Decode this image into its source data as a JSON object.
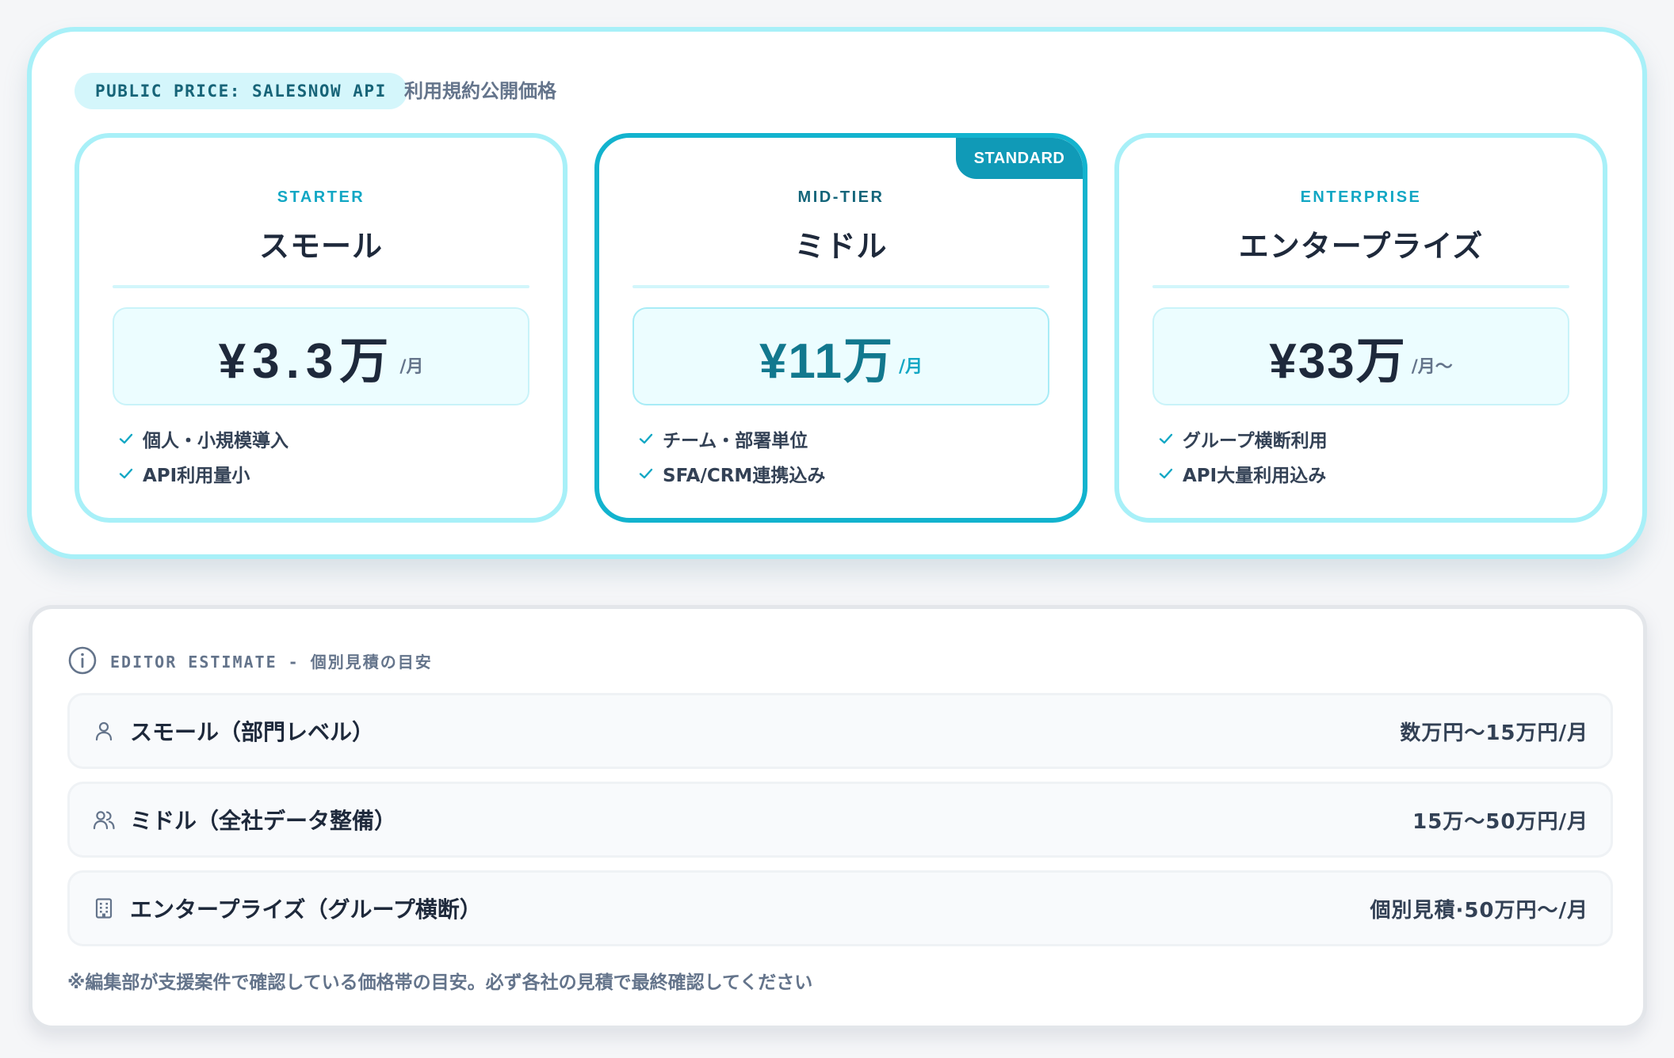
{
  "public_price": {
    "badge": "PUBLIC PRICE: SALESNOW API",
    "caption": "利用規約公開価格",
    "plans": [
      {
        "tier": "STARTER",
        "name": "スモール",
        "price": "¥3.3万",
        "unit": "/月",
        "features": [
          "個人・小規模導入",
          "API利用量小"
        ]
      },
      {
        "tier": "MID-TIER",
        "name": "ミドル",
        "price": "¥11万",
        "unit": "/月",
        "ribbon": "STANDARD",
        "features": [
          "チーム・部署単位",
          "SFA/CRM連携込み"
        ]
      },
      {
        "tier": "ENTERPRISE",
        "name": "エンタープライズ",
        "price": "¥33万",
        "unit": "/月〜",
        "features": [
          "グループ横断利用",
          "API大量利用込み"
        ]
      }
    ]
  },
  "editor_estimate": {
    "title": "EDITOR ESTIMATE - 個別見積の目安",
    "rows": [
      {
        "icon": "user-icon",
        "label": "スモール（部門レベル）",
        "value": "数万円〜15万円/月"
      },
      {
        "icon": "users-icon",
        "label": "ミドル（全社データ整備）",
        "value": "15万〜50万円/月"
      },
      {
        "icon": "building-icon",
        "label": "エンタープライズ（グループ横断）",
        "value": "個別見積·50万円〜/月"
      }
    ],
    "note": "※編集部が支援案件で確認している価格帯の目安。必ず各社の見積で最終確認してください"
  },
  "colors": {
    "accent": "#12b3ce",
    "accent_light": "#a8f0f8",
    "ribbon": "#109ab7",
    "text_dark": "#1e293b",
    "text_muted": "#64748b"
  }
}
